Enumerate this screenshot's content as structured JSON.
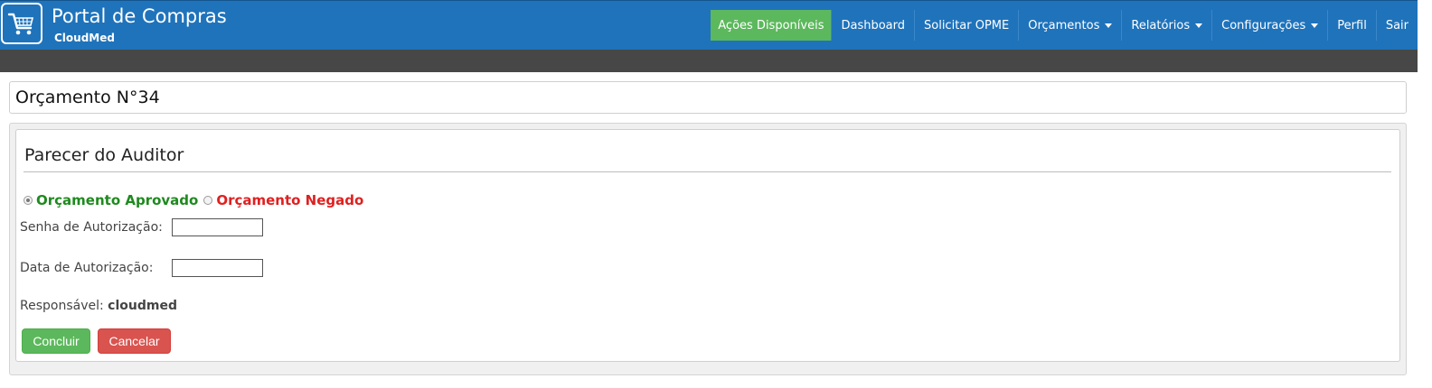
{
  "brand": {
    "title": "Portal de Compras",
    "subtitle": "CloudMed",
    "icon": "shopping-cart-icon"
  },
  "nav": {
    "items": [
      {
        "label": "Ações Disponíveis",
        "active": true,
        "dropdown": false
      },
      {
        "label": "Dashboard",
        "active": false,
        "dropdown": false
      },
      {
        "label": "Solicitar OPME",
        "active": false,
        "dropdown": false
      },
      {
        "label": "Orçamentos",
        "active": false,
        "dropdown": true
      },
      {
        "label": "Relatórios",
        "active": false,
        "dropdown": true
      },
      {
        "label": "Configurações",
        "active": false,
        "dropdown": true
      },
      {
        "label": "Perfil",
        "active": false,
        "dropdown": false
      },
      {
        "label": "Sair",
        "active": false,
        "dropdown": false
      }
    ]
  },
  "page": {
    "title": "Orçamento N°34"
  },
  "auditor": {
    "section_title": "Parecer do Auditor",
    "radio_approved": "Orçamento Aprovado",
    "radio_denied": "Orçamento Negado",
    "selected": "approved",
    "senha_label": "Senha de Autorização:",
    "senha_value": "",
    "data_label": "Data de Autorização:",
    "data_value": "",
    "responsavel_label": "Responsável:",
    "responsavel_value": "cloudmed",
    "conclude_label": "Concluir",
    "cancel_label": "Cancelar"
  },
  "colors": {
    "navbar": "#1f73bb",
    "active_nav": "#5cb85c",
    "subbar": "#474747",
    "approved": "#1e8a1e",
    "denied": "#e02020",
    "success_button": "#5cb85c",
    "danger_button": "#d9534f"
  }
}
